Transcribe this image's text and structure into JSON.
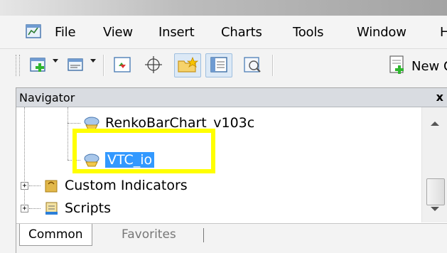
{
  "menubar": {
    "items": [
      {
        "label": "File"
      },
      {
        "label": "View"
      },
      {
        "label": "Insert"
      },
      {
        "label": "Charts"
      },
      {
        "label": "Tools"
      },
      {
        "label": "Window"
      },
      {
        "label": "H"
      }
    ]
  },
  "toolbar": {
    "new_order_label": "New Ord"
  },
  "navigator": {
    "title": "Navigator",
    "close_label": "x",
    "tree": [
      {
        "label": "RenkoBarChart_v103c",
        "selected": false
      },
      {
        "label": "VTC_io",
        "selected": true
      },
      {
        "label": "Custom Indicators",
        "expander": "+"
      },
      {
        "label": "Scripts",
        "expander": "+"
      }
    ],
    "tabs": [
      {
        "label": "Common",
        "active": true
      },
      {
        "label": "Favorites",
        "active": false
      }
    ]
  },
  "colors": {
    "selection": "#3399ff",
    "highlight": "#ffff00",
    "panel_header": "#d9dce1"
  }
}
